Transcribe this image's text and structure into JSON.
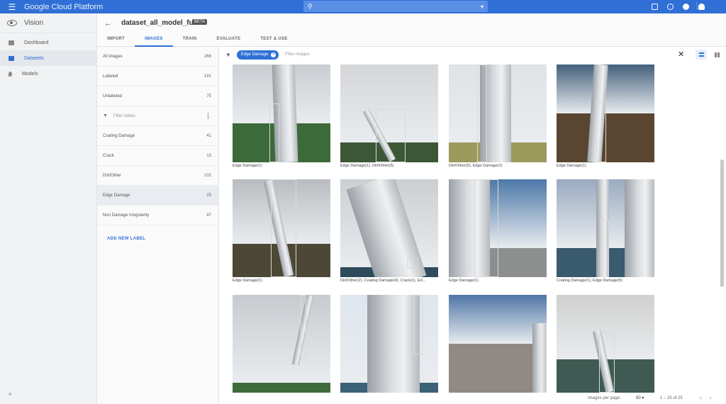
{
  "topbar": {
    "menu_icon": "hamburger-icon",
    "brand": "Google Cloud Platform",
    "search_icon": "search-icon",
    "search_caret": "▾"
  },
  "nav": {
    "product": "Vision",
    "items": [
      {
        "label": "Dashboard",
        "active": false
      },
      {
        "label": "Datasets",
        "active": true
      },
      {
        "label": "Models",
        "active": false
      }
    ],
    "collapse": "«"
  },
  "header": {
    "back": "←",
    "title": "dataset_all_model_full",
    "badge": "BETA",
    "tabs": [
      {
        "label": "IMPORT",
        "active": false
      },
      {
        "label": "IMAGES",
        "active": true
      },
      {
        "label": "TRAIN",
        "active": false
      },
      {
        "label": "EVALUATE",
        "active": false
      },
      {
        "label": "TEST & USE",
        "active": false
      }
    ]
  },
  "labels_panel": {
    "summary": [
      {
        "label": "All images",
        "count": "266"
      },
      {
        "label": "Labeled",
        "count": "191"
      },
      {
        "label": "Unlabeled",
        "count": "75"
      }
    ],
    "filter_placeholder": "Filter labels",
    "labels": [
      {
        "label": "Coating Damage",
        "count": "41",
        "active": false
      },
      {
        "label": "Crack",
        "count": "13",
        "active": false
      },
      {
        "label": "Dirt/Other",
        "count": "102",
        "active": false
      },
      {
        "label": "Edge Damage",
        "count": "25",
        "active": true
      },
      {
        "label": "Non Damage Irregularity",
        "count": "87",
        "active": false
      }
    ],
    "add_label": "ADD NEW LABEL"
  },
  "gallery": {
    "chip": "Edge Damage",
    "chip_x": "×",
    "filter_placeholder": "Filter images",
    "close": "✕",
    "tiles": [
      {
        "caption": "Edge Damage(1)"
      },
      {
        "caption": "Edge Damage(1), Dirt/Other(5)"
      },
      {
        "caption": "Dirt/Other(5), Edge Damage(1)"
      },
      {
        "caption": "Edge Damage(1)"
      },
      {
        "caption": "Edge Damage(1)"
      },
      {
        "caption": "Dirt/Other(2), Coating Damage(4), Crack(1), Ed..."
      },
      {
        "caption": "Edge Damage(1)"
      },
      {
        "caption": "Coating Damage(1), Edge Damage(5)"
      },
      {
        "caption": ""
      },
      {
        "caption": ""
      },
      {
        "caption": ""
      },
      {
        "caption": ""
      }
    ]
  },
  "footer": {
    "images_per_page_label": "Images per page:",
    "images_per_page_value": "50 ▾",
    "range": "1 – 25 of 25",
    "prev": "‹",
    "next": "›"
  }
}
